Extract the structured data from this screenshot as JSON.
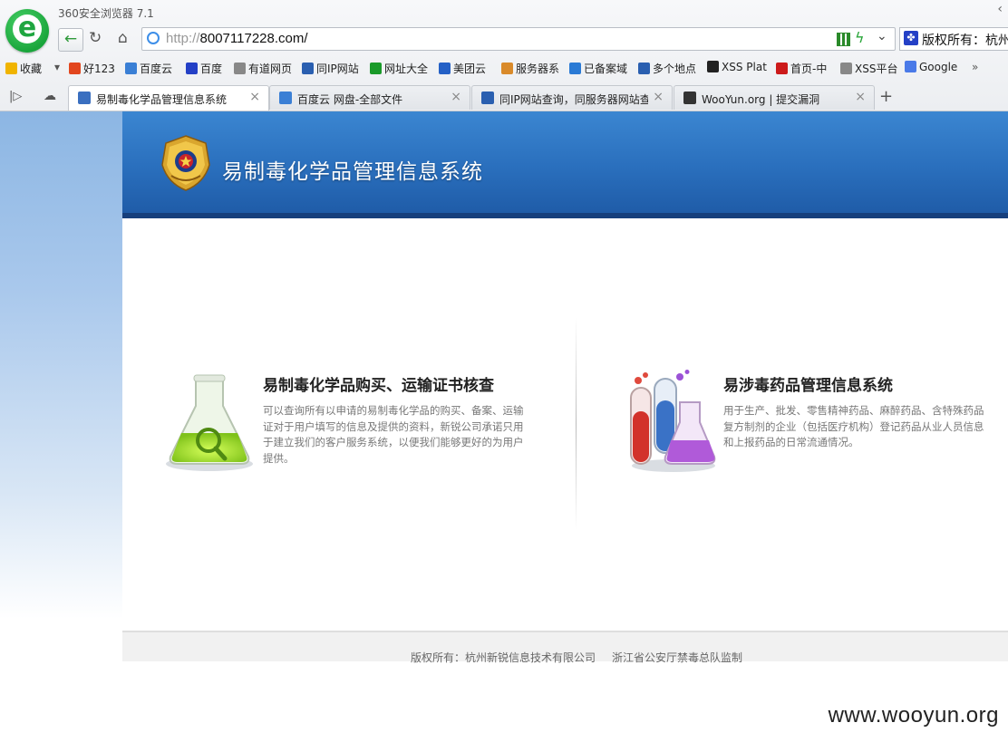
{
  "browser": {
    "app_title": "360安全浏览器 7.1",
    "address": {
      "scheme": "http://",
      "host": "8007117228.com/"
    },
    "search_text": "版权所有：杭州"
  },
  "bookmarks": [
    {
      "label": "收藏",
      "icon": "star-icon",
      "color": "#f0b400"
    },
    {
      "label": "好123",
      "icon": "hao123-icon",
      "color": "#e2461e"
    },
    {
      "label": "百度云",
      "icon": "baidu-cloud-icon",
      "color": "#3a7fd5"
    },
    {
      "label": "百度",
      "icon": "baidu-paw-icon",
      "color": "#2440c6"
    },
    {
      "label": "有道网页",
      "icon": "page-icon",
      "color": "#888888"
    },
    {
      "label": "同IP网站",
      "icon": "same-ip-icon",
      "color": "#2a5fb0"
    },
    {
      "label": "网址大全",
      "icon": "url-directory-icon",
      "color": "#1a9a2a"
    },
    {
      "label": "美团云",
      "icon": "meituan-cloud-icon",
      "color": "#2460c6"
    },
    {
      "label": "服务器系",
      "icon": "server-icon",
      "color": "#d98a2a"
    },
    {
      "label": "已备案域",
      "icon": "icp-icon",
      "color": "#2a7ad5"
    },
    {
      "label": "多个地点",
      "icon": "multi-location-icon",
      "color": "#2a5fb0"
    },
    {
      "label": "XSS Plat",
      "icon": "skull-icon",
      "color": "#222222"
    },
    {
      "label": "首页-中",
      "icon": "homepage-icon",
      "color": "#cc1a1a"
    },
    {
      "label": "XSS平台",
      "icon": "page-icon",
      "color": "#888888"
    },
    {
      "label": "Google",
      "icon": "google-translate-icon",
      "color": "#4a7ae8"
    }
  ],
  "tabs": [
    {
      "title": "易制毒化学品管理信息系统",
      "active": true,
      "icon_color": "#3a6fc0"
    },
    {
      "title": "百度云 网盘-全部文件",
      "active": false,
      "icon_color": "#3a7fd5"
    },
    {
      "title": "同IP网站查询，同服务器网站查",
      "active": false,
      "icon_color": "#2a5fb0"
    },
    {
      "title": "WooYun.org | 提交漏洞",
      "active": false,
      "icon_color": "#333333"
    }
  ],
  "page": {
    "site_title": "易制毒化学品管理信息系统",
    "cards": [
      {
        "title": "易制毒化学品购买、运输证书核查",
        "description": "可以查询所有以申请的易制毒化学品的购买、备案、运输证对于用户填写的信息及提供的资料，新锐公司承诺只用于建立我们的客户服务系统，以便我们能够更好的为用户提供。"
      },
      {
        "title": "易涉毒药品管理信息系统",
        "description": "用于生产、批发、零售精神药品、麻醉药品、含特殊药品复方制剂的企业（包括医疗机构）登记药品从业人员信息和上报药品的日常流通情况。"
      }
    ],
    "footer": {
      "copyright": "版权所有：杭州新锐信息技术有限公司",
      "supervisor": "浙江省公安厅禁毒总队监制"
    }
  },
  "watermark": "www.wooyun.org"
}
